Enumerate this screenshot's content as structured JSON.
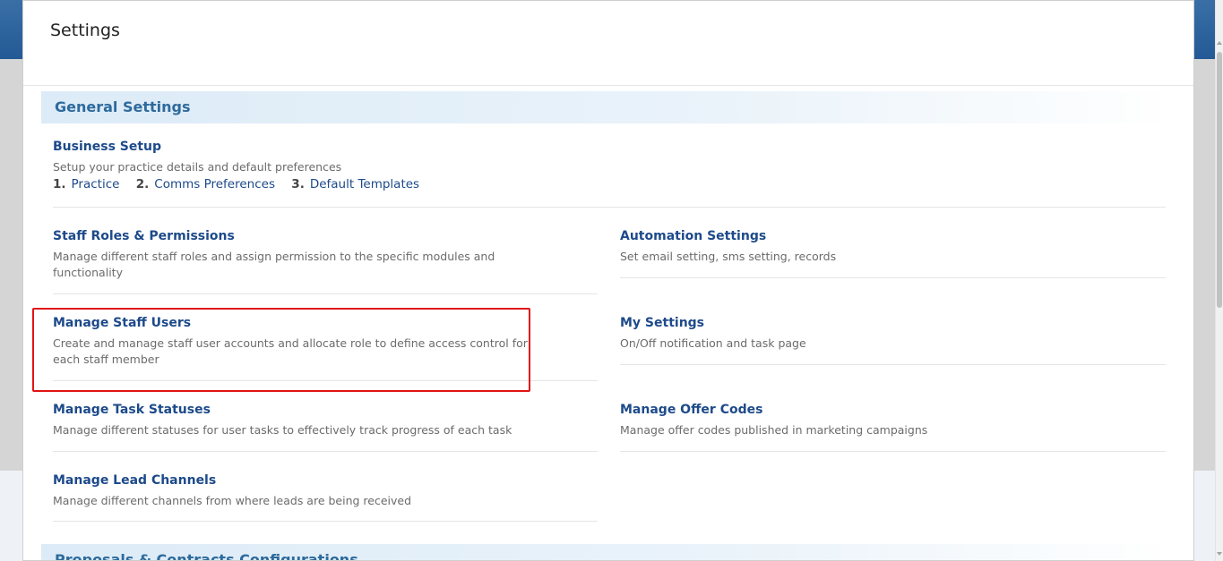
{
  "modal": {
    "title": "Settings"
  },
  "sections": {
    "general": "General Settings",
    "proposals": "Proposals & Contracts Configurations"
  },
  "business_setup": {
    "title": "Business Setup",
    "desc": "Setup your practice details and default preferences",
    "steps": [
      {
        "num": "1.",
        "label": "Practice"
      },
      {
        "num": "2.",
        "label": "Comms Preferences"
      },
      {
        "num": "3.",
        "label": "Default Templates"
      }
    ]
  },
  "items": {
    "staff_roles": {
      "title": "Staff Roles & Permissions",
      "desc": "Manage different staff roles and assign permission to the specific modules and functionality"
    },
    "automation": {
      "title": "Automation Settings",
      "desc": "Set email setting, sms setting, records"
    },
    "staff_users": {
      "title": "Manage Staff Users",
      "desc": "Create and manage staff user accounts and allocate role to define access control for each staff member"
    },
    "my_settings": {
      "title": "My Settings",
      "desc": "On/Off notification and task page"
    },
    "task_statuses": {
      "title": "Manage Task Statuses",
      "desc": "Manage different statuses for user tasks to effectively track progress of each task"
    },
    "offer_codes": {
      "title": "Manage Offer Codes",
      "desc": "Manage offer codes published in marketing campaigns"
    },
    "lead_channels": {
      "title": "Manage Lead Channels",
      "desc": "Manage different channels from where leads are being received"
    }
  },
  "colors": {
    "header_blue": "#235a95",
    "link_blue": "#1d4a8a",
    "section_text": "#2e6a9c",
    "highlight_red": "#e11414"
  }
}
